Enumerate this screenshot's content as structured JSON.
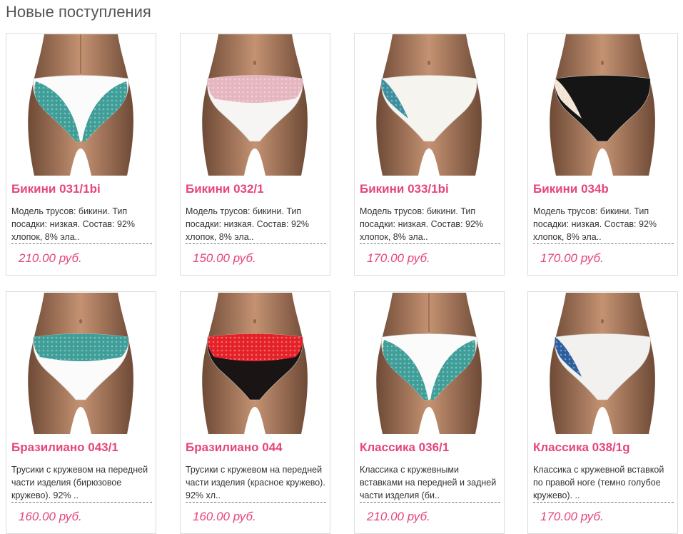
{
  "section": {
    "title": "Новые поступления"
  },
  "products": [
    {
      "name": "Бикини 031/1bi",
      "description": "Модель трусов: бикини. Тип посадки: низкая. Состав: 92% хлопок, 8% эла..",
      "price": "210.00 руб.",
      "view": "back",
      "fabric": "#fbfbfb",
      "lace": "#3f9e98"
    },
    {
      "name": "Бикини 032/1",
      "description": "Модель трусов: бикини. Тип посадки: низкая. Состав: 92% хлопок, 8% эла..",
      "price": "150.00 руб.",
      "view": "front",
      "fabric": "#f7f4f4",
      "lace": "#e6b6c0"
    },
    {
      "name": "Бикини 033/1bi",
      "description": "Модель трусов: бикини. Тип посадки: низкая. Состав: 92% хлопок, 8% эла..",
      "price": "170.00 руб.",
      "view": "side",
      "fabric": "#f6f4ee",
      "lace": "#3d8fa0"
    },
    {
      "name": "Бикини 034b",
      "description": "Модель трусов: бикини. Тип посадки: низкая. Состав: 92% хлопок, 8% эла..",
      "price": "170.00 руб.",
      "view": "side",
      "fabric": "#151515",
      "lace": "#f3e4d4"
    },
    {
      "name": "Бразилиано 043/1",
      "description": "Трусики с кружевом на передней части изделия (бирюзовое кружево). 92% ..",
      "price": "160.00 руб.",
      "view": "front",
      "fabric": "#fbfbfb",
      "lace": "#3f9e98"
    },
    {
      "name": "Бразилиано 044",
      "description": "Трусики с кружевом на передней части изделия (красное кружево). 92% хл..",
      "price": "160.00 руб.",
      "view": "front",
      "fabric": "#1a1414",
      "lace": "#e52128"
    },
    {
      "name": "Классика 036/1",
      "description": "Классика с кружевными вставками на передней и задней части изделия (би..",
      "price": "210.00 руб.",
      "view": "back",
      "fabric": "#fbfbfb",
      "lace": "#3f9e98"
    },
    {
      "name": "Классика 038/1g",
      "description": "Классика с кружевной вставкой по правой ноге (темно голубое кружево). ..",
      "price": "170.00 руб.",
      "view": "side",
      "fabric": "#f2f1ef",
      "lace": "#2c5f9e"
    }
  ]
}
